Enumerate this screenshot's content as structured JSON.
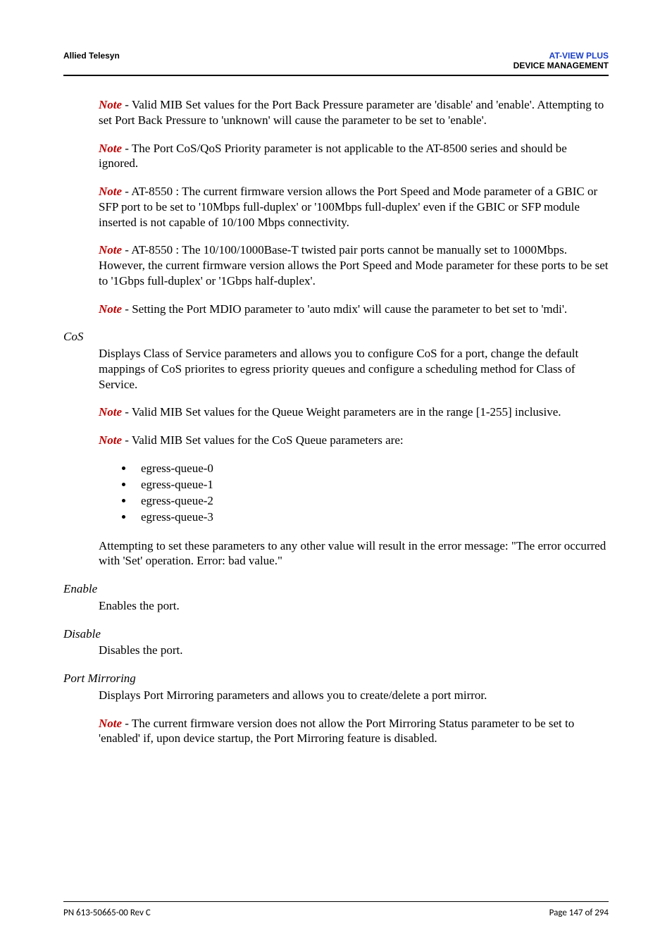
{
  "header": {
    "left": "Allied Telesyn",
    "right_line1": "AT-VIEW PLUS",
    "right_line2": "DEVICE MANAGEMENT"
  },
  "notes": {
    "n1": " - Valid MIB Set values for the Port Back Pressure parameter are 'disable' and 'enable'. Attempting to set Port Back Pressure to 'unknown' will cause the parameter to be set to 'enable'.",
    "n2": " - The Port CoS/QoS Priority parameter is not applicable to the AT-8500 series and should be ignored.",
    "n3": " - AT-8550 : The current firmware version allows the Port Speed and Mode parameter of a GBIC or SFP port to be set to '10Mbps full-duplex' or '100Mbps full-duplex' even if the GBIC or SFP module inserted is not capable of 10/100 Mbps connectivity.",
    "n4": " - AT-8550 : The 10/100/1000Base-T twisted pair ports cannot be manually set to 1000Mbps. However, the current firmware version allows the Port Speed and Mode parameter for these ports to be set to '1Gbps full-duplex' or '1Gbps half-duplex'.",
    "n5": " - Setting the Port MDIO parameter to 'auto mdix' will cause the parameter to bet set to 'mdi'.",
    "n6": " - Valid MIB Set values for the Queue Weight parameters are in the range [1-255] inclusive.",
    "n7": " - Valid MIB Set values for the CoS Queue parameters are:",
    "n8": " - The current firmware version does not allow the Port Mirroring Status parameter to be set to 'enabled' if, upon device startup, the Port Mirroring feature is disabled."
  },
  "note_label": "Note",
  "sections": {
    "cos": {
      "heading": "CoS",
      "body": "Displays Class of Service parameters and allows you to configure CoS for a port, change the default mappings of CoS priorites to egress priority queues and configure a scheduling method for Class of Service.",
      "bullets": [
        "egress-queue-0",
        "egress-queue-1",
        "egress-queue-2",
        "egress-queue-3"
      ],
      "after_bullets": "Attempting to set these parameters to any other value will result in the error message: \"The error occurred with 'Set' operation. Error: bad value.\""
    },
    "enable": {
      "heading": "Enable",
      "body": "Enables the port."
    },
    "disable": {
      "heading": "Disable",
      "body": "Disables the port."
    },
    "port_mirroring": {
      "heading": "Port Mirroring",
      "body": "Displays Port Mirroring parameters and allows you to create/delete a port mirror."
    }
  },
  "footer": {
    "left": "PN 613-50665-00 Rev C",
    "right": "Page 147 of 294"
  }
}
